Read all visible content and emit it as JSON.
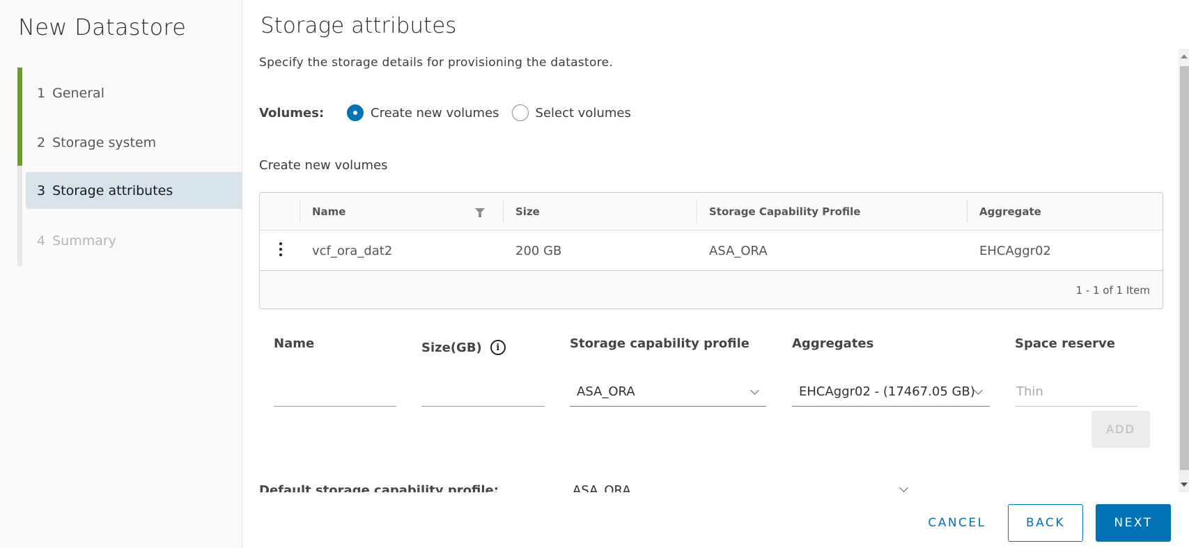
{
  "wizard": {
    "title": "New Datastore",
    "steps": [
      {
        "num": "1",
        "label": "General",
        "state": "done"
      },
      {
        "num": "2",
        "label": "Storage system",
        "state": "done"
      },
      {
        "num": "3",
        "label": "Storage attributes",
        "state": "active"
      },
      {
        "num": "4",
        "label": "Summary",
        "state": "disabled"
      }
    ]
  },
  "page": {
    "title": "Storage attributes",
    "description": "Specify the storage details for provisioning the datastore."
  },
  "volumes": {
    "label": "Volumes:",
    "options": [
      {
        "label": "Create new volumes",
        "checked": true
      },
      {
        "label": "Select volumes",
        "checked": false
      }
    ],
    "section_label": "Create new volumes"
  },
  "table": {
    "columns": [
      "Name",
      "Size",
      "Storage Capability Profile",
      "Aggregate"
    ],
    "rows": [
      {
        "name": "vcf_ora_dat2",
        "size": "200 GB",
        "profile": "ASA_ORA",
        "aggregate": "EHCAggr02"
      }
    ],
    "footer": "1 - 1 of 1 Item"
  },
  "form": {
    "name_label": "Name",
    "name_value": "",
    "size_label": "Size(GB)",
    "size_value": "",
    "profile_label": "Storage capability profile",
    "profile_value": "ASA_ORA",
    "aggregates_label": "Aggregates",
    "aggregates_value": "EHCAggr02 - (17467.05 GB)",
    "space_reserve_label": "Space reserve",
    "space_reserve_value": "Thin",
    "add_label": "ADD"
  },
  "default_profile": {
    "label": "Default storage capability profile:",
    "value": "ASA_ORA"
  },
  "footer": {
    "cancel": "CANCEL",
    "back": "BACK",
    "next": "NEXT"
  },
  "colors": {
    "primary": "#0072b5",
    "step_done": "#62a420",
    "active_step_bg": "#d8e3e9"
  }
}
